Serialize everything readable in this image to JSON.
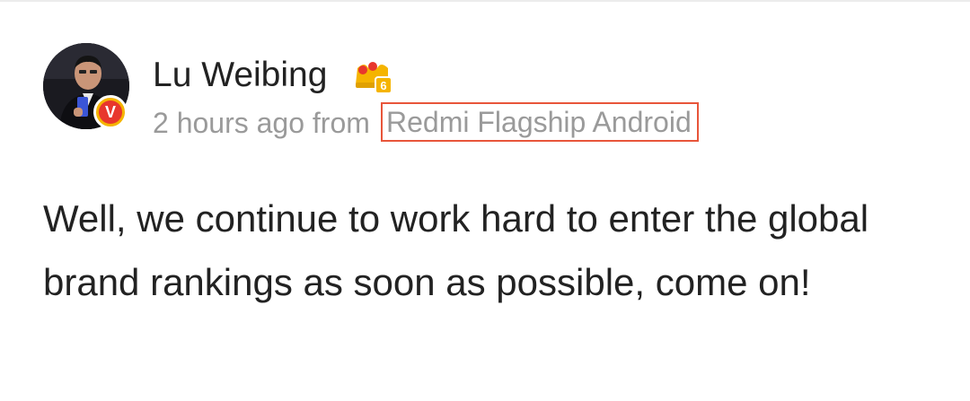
{
  "post": {
    "author": {
      "name": "Lu Weibing",
      "verified_label": "V",
      "badge_icon": "crown-level-icon",
      "badge_level": "6"
    },
    "meta": {
      "time": "2 hours ago from",
      "source": "Redmi Flagship Android"
    },
    "body": "Well, we continue to work hard to enter the global brand rankings as soon as possible, come on!"
  },
  "colors": {
    "text": "#222222",
    "meta": "#9a9a9a",
    "highlight_border": "#e8553a",
    "verified_bg": "#e8372d",
    "crown": "#f5b400"
  }
}
